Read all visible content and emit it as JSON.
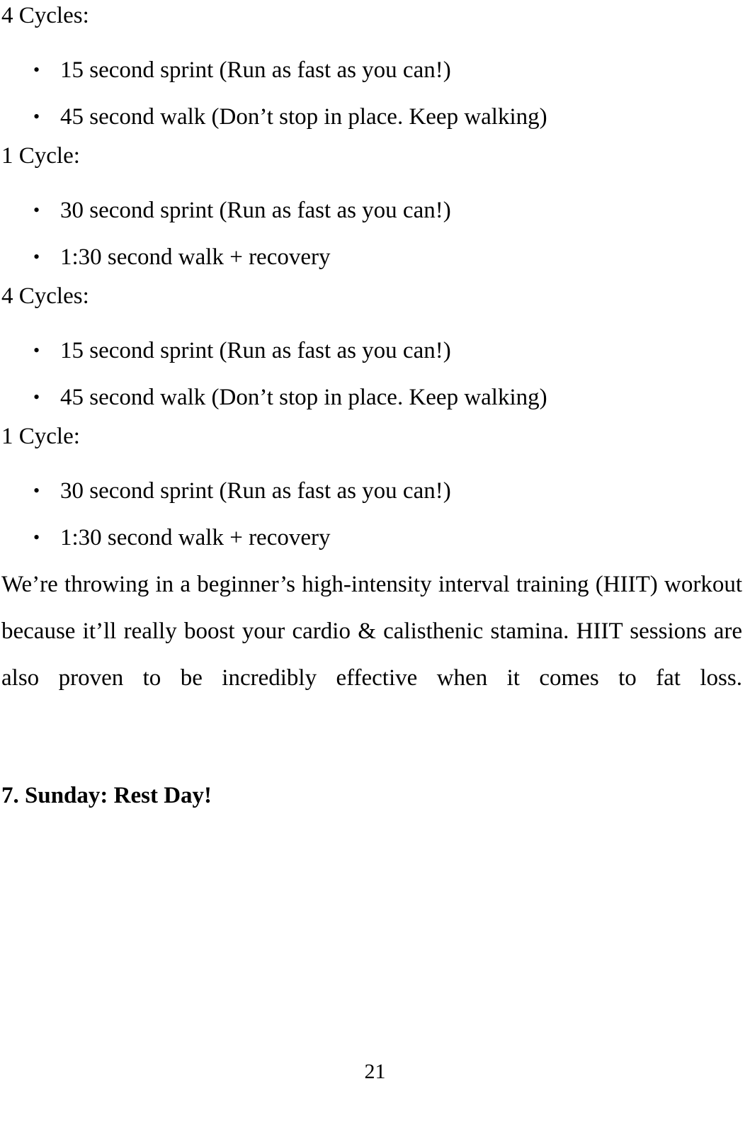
{
  "page": {
    "number": "21",
    "background": "#ffffff",
    "text_color": "#000000"
  },
  "blocks": [
    {
      "type": "cycle_heading",
      "text": "4 Cycles:"
    },
    {
      "type": "bullet_list",
      "items": [
        "15 second sprint (Run as fast as you can!)",
        "45 second walk (Don’t stop in place. Keep walking)"
      ]
    },
    {
      "type": "cycle_heading",
      "text": "1 Cycle:"
    },
    {
      "type": "bullet_list",
      "items": [
        "30 second sprint (Run as fast as you can!)",
        "1:30 second walk + recovery"
      ]
    },
    {
      "type": "cycle_heading",
      "text": "4 Cycles:"
    },
    {
      "type": "bullet_list",
      "items": [
        "15 second sprint (Run as fast as you can!)",
        "45 second walk (Don’t stop in place. Keep walking)"
      ]
    },
    {
      "type": "cycle_heading",
      "text": "1 Cycle:"
    },
    {
      "type": "bullet_list",
      "items": [
        "30 second sprint (Run as fast as you can!)",
        "1:30 second walk + recovery"
      ]
    },
    {
      "type": "paragraph",
      "text": "We’re throwing in a beginner’s high-intensity interval training (HIIT) workout because it’ll really boost your cardio & calisthenic stamina. HIIT sessions are also proven to be incredibly effective when it comes to fat loss."
    },
    {
      "type": "section_heading",
      "text": "7. Sunday: Rest Day!"
    }
  ],
  "icons": {
    "bullet": "•"
  }
}
